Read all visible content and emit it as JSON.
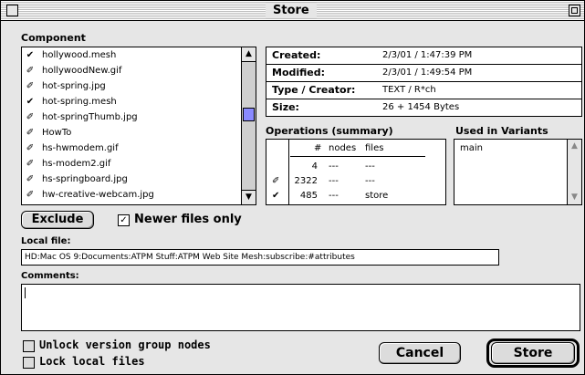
{
  "window": {
    "title": "Store"
  },
  "component": {
    "label": "Component",
    "items": [
      {
        "mark": "✔",
        "name": "hollywood.mesh"
      },
      {
        "mark": "✐",
        "name": "hollywoodNew.gif"
      },
      {
        "mark": "✐",
        "name": "hot-spring.jpg"
      },
      {
        "mark": "✔",
        "name": "hot-spring.mesh"
      },
      {
        "mark": "✐",
        "name": "hot-springThumb.jpg"
      },
      {
        "mark": "✐",
        "name": "HowTo"
      },
      {
        "mark": "✐",
        "name": "hs-hwmodem.gif"
      },
      {
        "mark": "✐",
        "name": "hs-modem2.gif"
      },
      {
        "mark": "✐",
        "name": "hs-springboard.jpg"
      },
      {
        "mark": "✐",
        "name": "hw-creative-webcam.jpg"
      }
    ]
  },
  "info": {
    "created_label": "Created:",
    "created_value": "2/3/01 / 1:47:39 PM",
    "modified_label": "Modified:",
    "modified_value": "2/3/01 / 1:49:54 PM",
    "type_label": "Type / Creator:",
    "type_value": "TEXT / R*ch",
    "size_label": "Size:",
    "size_value": "26 + 1454 Bytes"
  },
  "operations": {
    "label": "Operations (summary)",
    "headers": [
      "#",
      "nodes",
      "files"
    ],
    "rows": [
      {
        "mark": "",
        "count": "4",
        "nodes": "---",
        "files": "---"
      },
      {
        "mark": "✐",
        "count": "2322",
        "nodes": "---",
        "files": "---"
      },
      {
        "mark": "✔",
        "count": "485",
        "nodes": "---",
        "files": "store"
      }
    ]
  },
  "variants": {
    "label": "Used in Variants",
    "items": [
      "main"
    ]
  },
  "exclude_label": "Exclude",
  "newer_files_only": {
    "label": "Newer files only",
    "checked": true,
    "mark": "✓"
  },
  "local_file": {
    "label": "Local file:",
    "value": "HD:Mac OS 9:Documents:ATPM Stuff:ATPM Web Site Mesh:subscribe:#attributes"
  },
  "comments": {
    "label": "Comments:",
    "value": ""
  },
  "options": {
    "unlock_label": "Unlock version group nodes",
    "lock_label": "Lock local files"
  },
  "cancel_label": "Cancel",
  "store_label": "Store"
}
